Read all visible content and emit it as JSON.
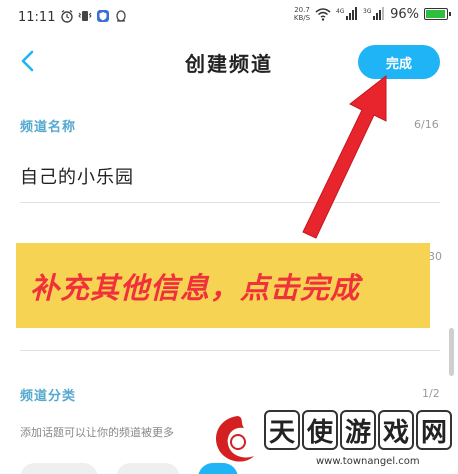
{
  "status_bar": {
    "time": "11:11",
    "net_speed_value": "20.7",
    "net_speed_unit": "KB/S",
    "battery_percent_text": "96%",
    "battery_level": 0.96,
    "icons": [
      "alarm-icon",
      "vibrate-icon",
      "shield-app-icon",
      "qq-icon",
      "wifi-icon",
      "signal-4g-icon",
      "signal-3g-icon",
      "battery-icon"
    ]
  },
  "header": {
    "back_icon": "chevron-left-icon",
    "title": "创建频道",
    "done_label": "完成"
  },
  "form": {
    "name_label": "频道名称",
    "name_count": "6/16",
    "name_value": "自己的小乐园",
    "second_count_partial": "30",
    "category_label": "频道分类",
    "category_count": "1/2",
    "topic_hint": "添加话题可以让你的频道被更多"
  },
  "annotation": {
    "banner_text": "补充其他信息，点击完成",
    "banner_color": "#f6d352",
    "text_color": "#f0303a",
    "arrow_color": "#e8242c"
  },
  "watermark": {
    "chars": [
      "天",
      "使",
      "游",
      "戏",
      "网"
    ],
    "url": "www.townangel.com"
  },
  "colors": {
    "accent": "#1fb4f5",
    "label": "#56a9cf"
  }
}
